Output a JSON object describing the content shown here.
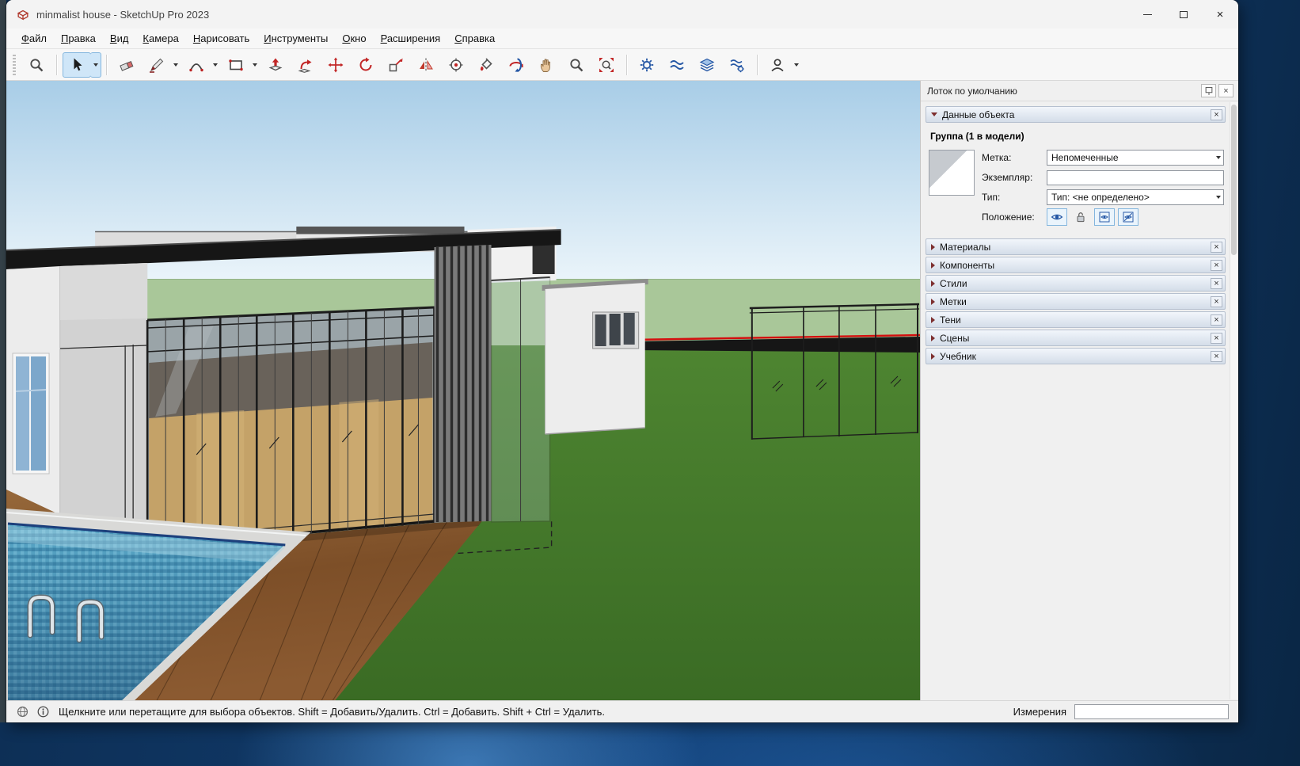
{
  "window": {
    "title": "minmalist house - SketchUp Pro 2023"
  },
  "menu": {
    "items": [
      "Файл",
      "Правка",
      "Вид",
      "Камера",
      "Нарисовать",
      "Инструменты",
      "Окно",
      "Расширения",
      "Справка"
    ]
  },
  "toolbar": {
    "groups": [
      [
        {
          "name": "search",
          "caret": false
        }
      ],
      [
        {
          "name": "select",
          "caret": true,
          "pressed": true
        }
      ],
      [
        {
          "name": "eraser",
          "caret": false
        },
        {
          "name": "line",
          "caret": true
        },
        {
          "name": "arc",
          "caret": true
        },
        {
          "name": "rectangle",
          "caret": true
        },
        {
          "name": "push-pull",
          "caret": false
        },
        {
          "name": "follow-me",
          "caret": false
        },
        {
          "name": "move",
          "caret": false
        },
        {
          "name": "rotate",
          "caret": false
        },
        {
          "name": "scale",
          "caret": false
        },
        {
          "name": "flip",
          "caret": false
        },
        {
          "name": "position-camera",
          "caret": false
        },
        {
          "name": "paint-bucket",
          "caret": false
        },
        {
          "name": "orbit",
          "caret": false
        },
        {
          "name": "pan",
          "caret": false
        },
        {
          "name": "zoom",
          "caret": false
        },
        {
          "name": "zoom-extents",
          "caret": false
        }
      ],
      [
        {
          "name": "model-info",
          "caret": false
        },
        {
          "name": "soften-edges",
          "caret": false
        },
        {
          "name": "tags-layers",
          "caret": false
        },
        {
          "name": "tray-settings",
          "caret": false
        }
      ],
      [
        {
          "name": "account",
          "caret": true
        }
      ]
    ]
  },
  "tray": {
    "title": "Лоток по умолчанию",
    "entity_info": {
      "title": "Данные объекта",
      "heading": "Группа (1 в модели)",
      "label_field": {
        "label": "Метка:",
        "value": "Непомеченные"
      },
      "instance_field": {
        "label": "Экземпляр:",
        "value": ""
      },
      "type_field": {
        "label": "Тип:",
        "value": "Тип: <не определено>"
      },
      "position_label": "Положение:",
      "toggles": [
        {
          "name": "hidden-toggle",
          "icon": "eye",
          "pressed": true
        },
        {
          "name": "lock-toggle",
          "icon": "padlock",
          "pressed": false
        },
        {
          "name": "hide-same-level-toggle",
          "icon": "eye-box",
          "pressed": true
        },
        {
          "name": "hide-rest-toggle",
          "icon": "eye-slash-box",
          "pressed": true
        }
      ]
    },
    "sections": [
      "Материалы",
      "Компоненты",
      "Стили",
      "Метки",
      "Тени",
      "Сцены",
      "Учебник"
    ]
  },
  "statusbar": {
    "hint": "Щелкните или перетащите для выбора объектов. Shift = Добавить/Удалить. Ctrl = Добавить. Shift + Ctrl = Удалить.",
    "measurements_label": "Измерения",
    "measurements_value": ""
  },
  "scene": {
    "sky_top": "#a8cde7",
    "sky_horizon": "#eaf4fa",
    "field_green": "#a9c799",
    "lawn_green": "#4e8531",
    "roof_color": "#161616",
    "wall_color": "#ececec",
    "deck_brown": "#7d4f28",
    "pool_blue": "#4e9abc",
    "axis_red": "#d40f0f"
  }
}
